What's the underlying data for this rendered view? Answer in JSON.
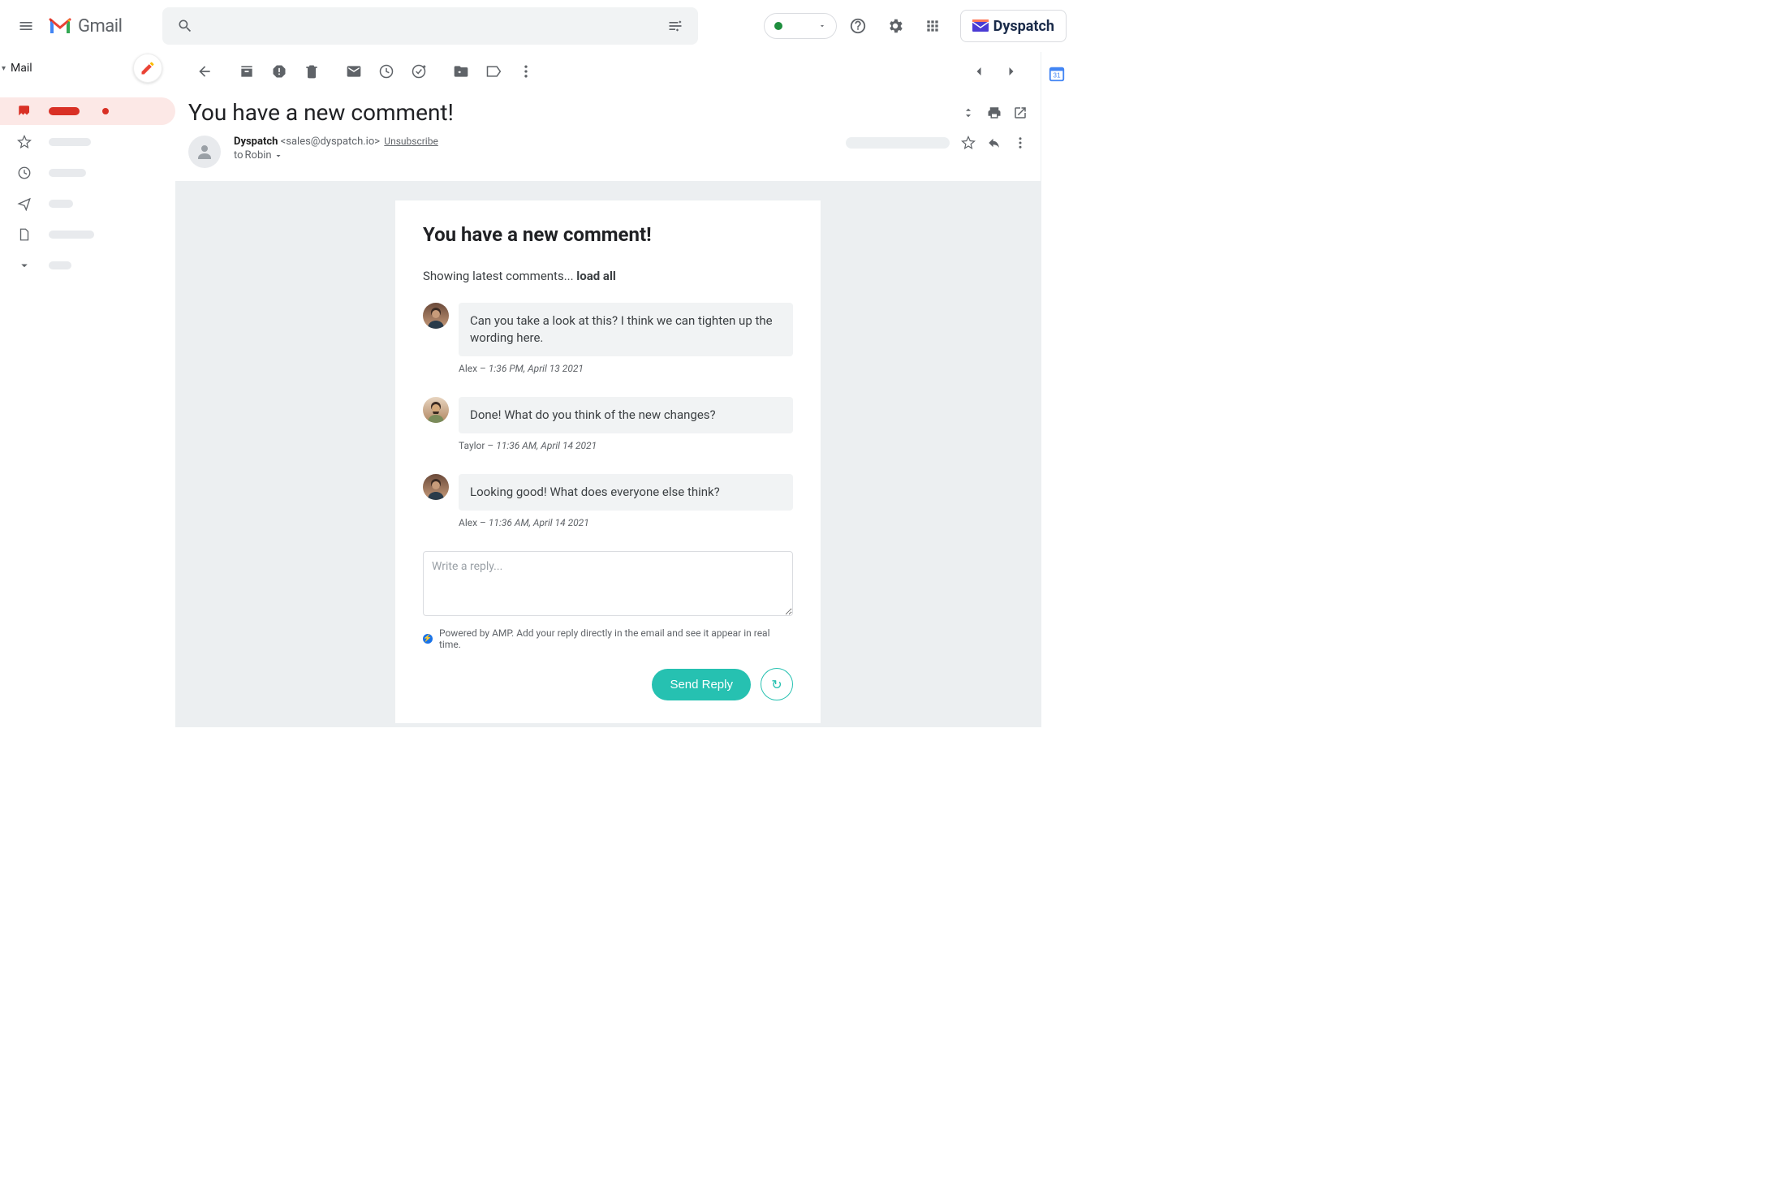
{
  "header": {
    "product": "Gmail",
    "search_placeholder": "",
    "addon_label": "Dyspatch"
  },
  "sidebar": {
    "mail_label": "Mail"
  },
  "subject": "You have a new comment!",
  "sender": {
    "name": "Dyspatch",
    "email": "<sales@dyspatch.io>",
    "unsubscribe": "Unsubscribe",
    "to_prefix": "to",
    "to_name": "Robin"
  },
  "email": {
    "title": "You have a new comment!",
    "loading_prefix": "Showing latest comments... ",
    "load_all": "load all",
    "comments": [
      {
        "author": "Alex",
        "sep": " – ",
        "timestamp": "1:36 PM, April 13 2021",
        "text": "Can you take a look at this? I think we can tighten up the wording here."
      },
      {
        "author": "Taylor",
        "sep": " – ",
        "timestamp": "11:36 AM, April 14 2021",
        "text": "Done! What do you think of the new changes?"
      },
      {
        "author": "Alex",
        "sep": " – ",
        "timestamp": "11:36 AM, April 14 2021",
        "text": "Looking good! What does everyone else think?"
      }
    ],
    "reply_placeholder": "Write a reply...",
    "amp_note": "Powered by AMP. Add your reply directly in the email and see it appear in real time.",
    "send_label": "Send Reply"
  }
}
